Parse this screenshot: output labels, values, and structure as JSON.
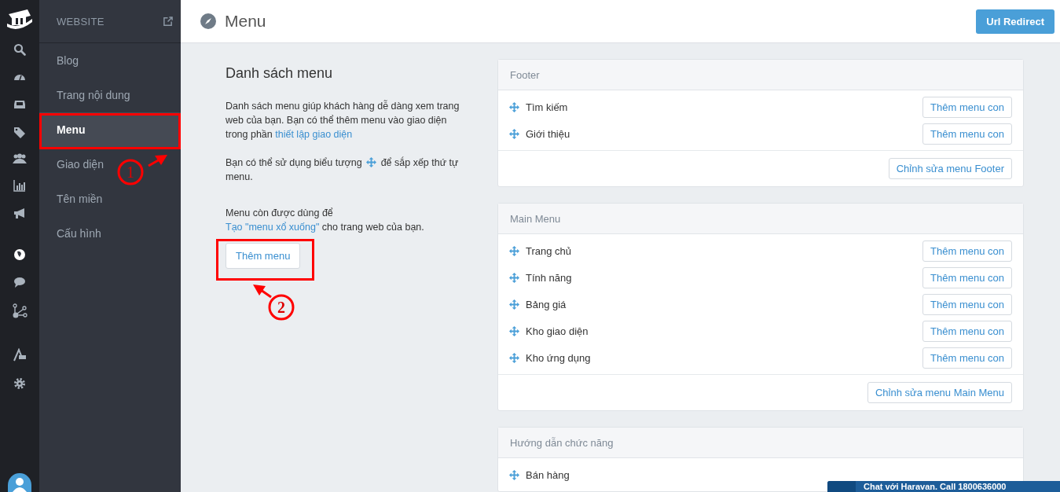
{
  "sidebar": {
    "title": "WEBSITE",
    "items": [
      {
        "label": "Blog",
        "selected": false
      },
      {
        "label": "Trang nội dung",
        "selected": false
      },
      {
        "label": "Menu",
        "selected": true
      },
      {
        "label": "Giao diện",
        "selected": false
      },
      {
        "label": "Tên miền",
        "selected": false
      },
      {
        "label": "Cấu hình",
        "selected": false
      }
    ]
  },
  "header": {
    "title": "Menu",
    "button": "Url Redirect"
  },
  "intro": {
    "heading": "Danh sách menu",
    "paragraph_1": {
      "text": "Danh sách menu giúp khách hàng dễ dàng xem trang web của bạn. Bạn có thể thêm menu vào giao diện trong phần ",
      "link": "thiết lập giao diện"
    },
    "paragraph_2": {
      "before": "Bạn có thể sử dụng biểu tượng",
      "after": "để sắp xếp thứ tự",
      "continued": "menu."
    },
    "paragraph_3": {
      "line": "Menu còn được dùng để",
      "link": "Tạo \"menu xổ xuống\"",
      "after": " cho trang web của bạn."
    },
    "button": "Thêm menu"
  },
  "panels": [
    {
      "title": "Footer",
      "items": [
        {
          "label": "Tìm kiếm",
          "add": "Thêm menu con"
        },
        {
          "label": "Giới thiệu",
          "add": "Thêm menu con"
        }
      ],
      "edit": "Chỉnh sửa menu Footer"
    },
    {
      "title": "Main Menu",
      "items": [
        {
          "label": "Trang chủ",
          "add": "Thêm menu con"
        },
        {
          "label": "Tính năng",
          "add": "Thêm menu con"
        },
        {
          "label": "Bảng giá",
          "add": "Thêm menu con"
        },
        {
          "label": "Kho giao diện",
          "add": "Thêm menu con"
        },
        {
          "label": "Kho ứng dụng",
          "add": "Thêm menu con"
        }
      ],
      "edit": "Chỉnh sửa menu Main Menu"
    },
    {
      "title": "Hướng dẫn chức năng",
      "items": [
        {
          "label": "Bán hàng"
        }
      ]
    }
  ],
  "chat": {
    "label": "Chat với Haravan. Call 1800636000"
  },
  "annotations": [
    {
      "label": "1"
    },
    {
      "label": "2"
    }
  ]
}
